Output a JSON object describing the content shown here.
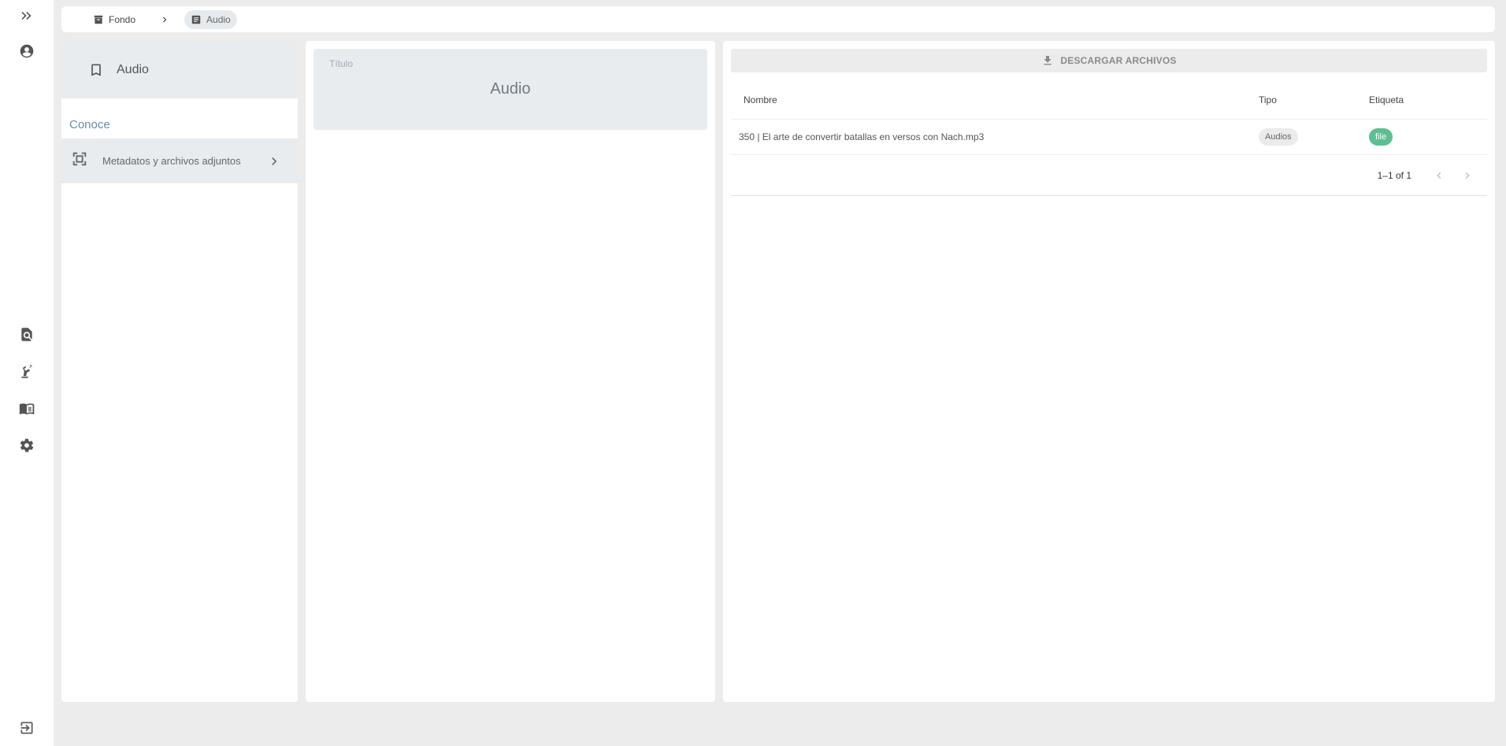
{
  "rail": {
    "icons": [
      "expand-icon",
      "account-icon",
      "search-document-icon",
      "robot-arm-icon",
      "book-icon",
      "gear-icon",
      "logout-icon"
    ]
  },
  "breadcrumb": {
    "items": [
      {
        "label": "Fondo",
        "icon": "archive-icon"
      },
      {
        "label": "Audio",
        "icon": "document-icon"
      }
    ]
  },
  "nav": {
    "header": "Audio",
    "section": "Conoce",
    "items": [
      {
        "label": "Metadatos y archivos adjuntos",
        "icon": "scan-frame-icon"
      }
    ]
  },
  "title_card": {
    "label": "Título",
    "value": "Audio"
  },
  "files": {
    "download_label": "DESCARGAR ARCHIVOS",
    "columns": {
      "name": "Nombre",
      "type": "Tipo",
      "tag": "Etiqueta"
    },
    "rows": [
      {
        "name": "350 | El arte de convertir batallas en versos con Nach.mp3",
        "type": "Audios",
        "tag": "file"
      }
    ],
    "pagination": "1–1 of 1"
  },
  "colors": {
    "background": "#ececec",
    "panel_header": "#e9ecef",
    "tag_chip": "#5dbf92",
    "section_accent": "#6a8ca5"
  }
}
